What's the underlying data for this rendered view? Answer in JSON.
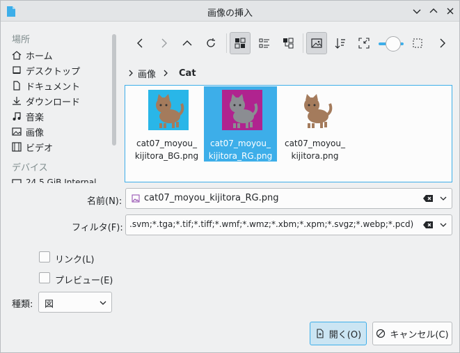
{
  "window": {
    "title": "画像の挿入"
  },
  "sidebar": {
    "places_heading": "場所",
    "items": [
      {
        "label": "ホーム",
        "icon": "home-icon"
      },
      {
        "label": "デスクトップ",
        "icon": "desktop-icon"
      },
      {
        "label": "ドキュメント",
        "icon": "document-icon"
      },
      {
        "label": "ダウンロード",
        "icon": "download-icon"
      },
      {
        "label": "音楽",
        "icon": "music-icon"
      },
      {
        "label": "画像",
        "icon": "image-icon"
      },
      {
        "label": "ビデオ",
        "icon": "video-icon"
      }
    ],
    "devices_heading": "デバイス",
    "device_partial": "24.5 GiB Internal"
  },
  "breadcrumb": {
    "parent": "画像",
    "current": "Cat"
  },
  "files": [
    {
      "name": "cat07_moyou_kijitora_BG.png",
      "line1": "cat07_moyou_",
      "line2": "kijitora_BG.png",
      "bg": "#29b6e8",
      "selected": false
    },
    {
      "name": "cat07_moyou_kijitora_RG.png",
      "line1": "cat07_moyou_",
      "line2": "kijitora_RG.png",
      "bg": "#b0238f",
      "selected": true
    },
    {
      "name": "cat07_moyou_kijitora.png",
      "line1": "cat07_moyou_",
      "line2": "kijitora.png",
      "bg": "",
      "selected": false
    }
  ],
  "form": {
    "name_label": "名前(N):",
    "name_value": "cat07_moyou_kijitora_RG.png",
    "filter_label": "フィルタ(F):",
    "filter_value": ".svm;*.tga;*.tif;*.tiff;*.wmf;*.wmz;*.xbm;*.xpm;*.svgz;*.webp;*.pcd)",
    "link_label": "リンク(L)",
    "preview_label": "プレビュー(E)",
    "type_label": "種類:",
    "type_value": "図"
  },
  "buttons": {
    "open": "開く(O)",
    "cancel": "キャンセル(C)"
  },
  "colors": {
    "accent": "#3daee9",
    "selected_bg": "#3daee9"
  }
}
